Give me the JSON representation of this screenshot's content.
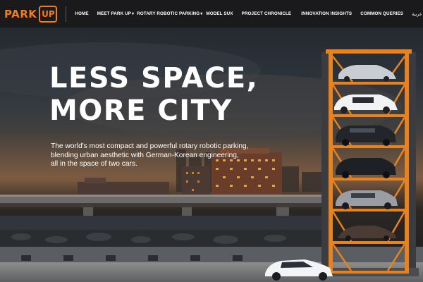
{
  "brand": {
    "logo_text": "PARK",
    "logo_mark": "UP",
    "accent_color": "#ef7d1a"
  },
  "nav": {
    "items": [
      {
        "label": "HOME"
      },
      {
        "label": "MEET PARK UP",
        "has_dropdown": true
      },
      {
        "label": "ROTARY ROBOTIC PARKING",
        "has_dropdown": true
      },
      {
        "label": "MODEL SUX"
      },
      {
        "label": "PROJECT CHRONICLE"
      },
      {
        "label": "INNOVATION INSIGHTS"
      },
      {
        "label": "COMMON QUERIES"
      },
      {
        "label": "عربية"
      }
    ]
  },
  "hero": {
    "headline_line1": "LESS SPACE,",
    "headline_line2": "MORE CITY",
    "subtext_line1": "The world's most compact and powerful rotary robotic parking,",
    "subtext_line2": "blending urban aesthetic with German-Korean engineering,",
    "subtext_line3": "all in the space of two cars.",
    "image": {
      "description_icon": "rotary-parking-tower-photo",
      "tower_color": "#e8821e"
    }
  }
}
